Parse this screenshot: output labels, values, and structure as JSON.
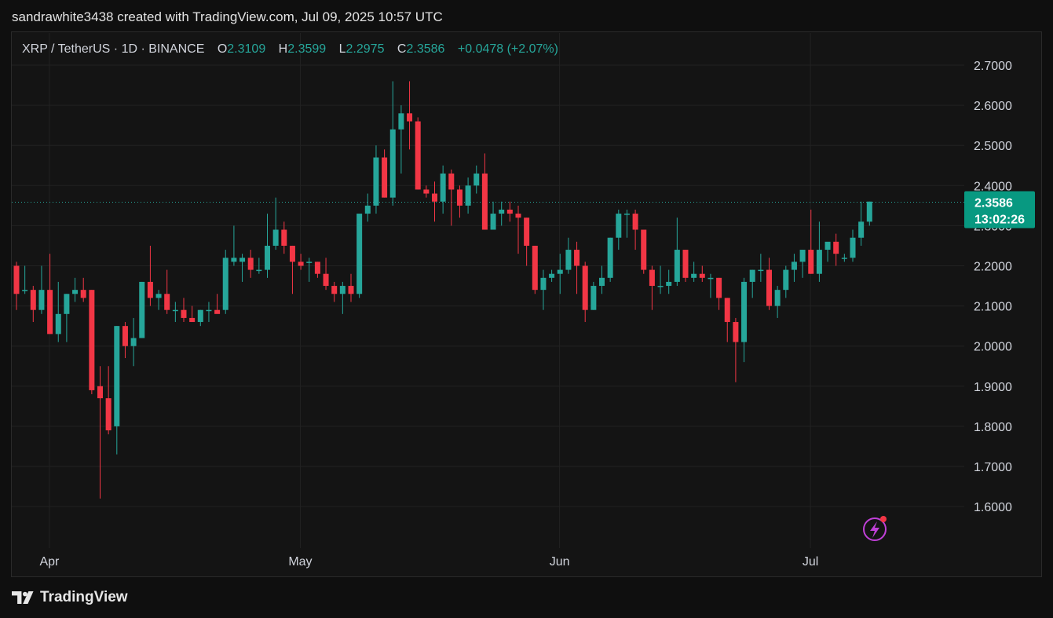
{
  "header": {
    "created_by": "sandrawhite3438 created with TradingView.com, Jul 09, 2025 10:57 UTC"
  },
  "legend": {
    "symbol": "XRP / TetherUS · 1D · BINANCE",
    "open_label": "O",
    "open": "2.3109",
    "high_label": "H",
    "high": "2.3599",
    "low_label": "L",
    "low": "2.2975",
    "close_label": "C",
    "close": "2.3586",
    "change": "+0.0478 (+2.07%)"
  },
  "price_badge": {
    "price": "2.3586",
    "countdown": "13:02:26"
  },
  "branding": {
    "logo_text": "TradingView"
  },
  "colors": {
    "up": "#26a69a",
    "down": "#f23645",
    "accent_badge": "#089981",
    "alert_icon": "#c040d8"
  },
  "icons": {
    "alert": "lightning-icon",
    "logo": "tradingview-logo-icon"
  },
  "chart_data": {
    "type": "candlestick",
    "y_ticks": [
      "2.7000",
      "2.6000",
      "2.5000",
      "2.4000",
      "2.3000",
      "2.2000",
      "2.1000",
      "2.0000",
      "1.9000",
      "1.8000",
      "1.7000",
      "1.6000"
    ],
    "ylim": [
      1.53,
      2.75
    ],
    "x_ticks": [
      {
        "label": "Apr",
        "index": 3
      },
      {
        "label": "May",
        "index": 33
      },
      {
        "label": "Jun",
        "index": 64
      },
      {
        "label": "Jul",
        "index": 94
      }
    ],
    "grid": true,
    "last_price_line": 2.3586,
    "candles": [
      [
        2.2,
        2.21,
        2.09,
        2.13
      ],
      [
        2.14,
        2.2,
        2.13,
        2.14
      ],
      [
        2.14,
        2.15,
        2.06,
        2.09
      ],
      [
        2.09,
        2.2,
        2.08,
        2.14
      ],
      [
        2.14,
        2.23,
        2.08,
        2.03
      ],
      [
        2.03,
        2.16,
        2.01,
        2.08
      ],
      [
        2.08,
        2.13,
        2.01,
        2.13
      ],
      [
        2.13,
        2.17,
        2.11,
        2.14
      ],
      [
        2.14,
        2.17,
        2.11,
        2.12
      ],
      [
        2.14,
        2.14,
        1.88,
        1.89
      ],
      [
        1.9,
        1.95,
        1.62,
        1.87
      ],
      [
        1.87,
        1.95,
        1.78,
        1.79
      ],
      [
        1.8,
        2.05,
        1.73,
        2.05
      ],
      [
        2.05,
        2.06,
        1.97,
        2.0
      ],
      [
        2.0,
        2.07,
        1.95,
        2.02
      ],
      [
        2.02,
        2.16,
        2.02,
        2.16
      ],
      [
        2.16,
        2.25,
        2.1,
        2.12
      ],
      [
        2.12,
        2.14,
        2.09,
        2.13
      ],
      [
        2.13,
        2.19,
        2.08,
        2.09
      ],
      [
        2.09,
        2.11,
        2.06,
        2.09
      ],
      [
        2.09,
        2.12,
        2.06,
        2.07
      ],
      [
        2.07,
        2.1,
        2.06,
        2.06
      ],
      [
        2.06,
        2.09,
        2.05,
        2.09
      ],
      [
        2.09,
        2.11,
        2.06,
        2.09
      ],
      [
        2.09,
        2.13,
        2.09,
        2.08
      ],
      [
        2.09,
        2.24,
        2.08,
        2.22
      ],
      [
        2.21,
        2.3,
        2.2,
        2.22
      ],
      [
        2.21,
        2.23,
        2.16,
        2.22
      ],
      [
        2.22,
        2.24,
        2.17,
        2.19
      ],
      [
        2.19,
        2.22,
        2.18,
        2.19
      ],
      [
        2.19,
        2.33,
        2.17,
        2.25
      ],
      [
        2.25,
        2.37,
        2.24,
        2.29
      ],
      [
        2.29,
        2.31,
        2.23,
        2.25
      ],
      [
        2.25,
        2.25,
        2.13,
        2.21
      ],
      [
        2.21,
        2.23,
        2.19,
        2.2
      ],
      [
        2.21,
        2.22,
        2.16,
        2.21
      ],
      [
        2.21,
        2.21,
        2.17,
        2.18
      ],
      [
        2.18,
        2.22,
        2.14,
        2.15
      ],
      [
        2.15,
        2.16,
        2.11,
        2.13
      ],
      [
        2.13,
        2.16,
        2.08,
        2.15
      ],
      [
        2.15,
        2.18,
        2.11,
        2.13
      ],
      [
        2.13,
        2.32,
        2.12,
        2.33
      ],
      [
        2.33,
        2.38,
        2.31,
        2.35
      ],
      [
        2.35,
        2.5,
        2.33,
        2.47
      ],
      [
        2.47,
        2.49,
        2.37,
        2.37
      ],
      [
        2.37,
        2.66,
        2.35,
        2.54
      ],
      [
        2.54,
        2.6,
        2.43,
        2.58
      ],
      [
        2.58,
        2.66,
        2.49,
        2.56
      ],
      [
        2.56,
        2.57,
        2.39,
        2.39
      ],
      [
        2.39,
        2.4,
        2.37,
        2.38
      ],
      [
        2.38,
        2.41,
        2.31,
        2.36
      ],
      [
        2.36,
        2.45,
        2.33,
        2.43
      ],
      [
        2.43,
        2.44,
        2.3,
        2.39
      ],
      [
        2.39,
        2.4,
        2.32,
        2.35
      ],
      [
        2.35,
        2.42,
        2.33,
        2.4
      ],
      [
        2.4,
        2.45,
        2.38,
        2.43
      ],
      [
        2.43,
        2.48,
        2.29,
        2.29
      ],
      [
        2.29,
        2.36,
        2.3,
        2.33
      ],
      [
        2.33,
        2.36,
        2.3,
        2.34
      ],
      [
        2.34,
        2.36,
        2.31,
        2.33
      ],
      [
        2.33,
        2.35,
        2.23,
        2.32
      ],
      [
        2.32,
        2.32,
        2.2,
        2.25
      ],
      [
        2.25,
        2.25,
        2.13,
        2.14
      ],
      [
        2.14,
        2.19,
        2.09,
        2.17
      ],
      [
        2.17,
        2.19,
        2.16,
        2.18
      ],
      [
        2.18,
        2.23,
        2.13,
        2.19
      ],
      [
        2.19,
        2.27,
        2.18,
        2.24
      ],
      [
        2.24,
        2.26,
        2.13,
        2.2
      ],
      [
        2.2,
        2.21,
        2.06,
        2.09
      ],
      [
        2.09,
        2.16,
        2.09,
        2.15
      ],
      [
        2.15,
        2.2,
        2.13,
        2.17
      ],
      [
        2.17,
        2.27,
        2.16,
        2.27
      ],
      [
        2.27,
        2.34,
        2.24,
        2.33
      ],
      [
        2.33,
        2.34,
        2.27,
        2.33
      ],
      [
        2.33,
        2.34,
        2.24,
        2.29
      ],
      [
        2.29,
        2.29,
        2.18,
        2.19
      ],
      [
        2.19,
        2.2,
        2.09,
        2.15
      ],
      [
        2.15,
        2.2,
        2.13,
        2.15
      ],
      [
        2.15,
        2.19,
        2.13,
        2.16
      ],
      [
        2.16,
        2.32,
        2.15,
        2.24
      ],
      [
        2.24,
        2.24,
        2.16,
        2.17
      ],
      [
        2.17,
        2.21,
        2.16,
        2.18
      ],
      [
        2.18,
        2.2,
        2.16,
        2.17
      ],
      [
        2.17,
        2.18,
        2.12,
        2.17
      ],
      [
        2.17,
        2.17,
        2.09,
        2.12
      ],
      [
        2.12,
        2.12,
        2.01,
        2.06
      ],
      [
        2.06,
        2.07,
        1.91,
        2.01
      ],
      [
        2.01,
        2.17,
        1.96,
        2.16
      ],
      [
        2.16,
        2.19,
        2.12,
        2.19
      ],
      [
        2.19,
        2.23,
        2.16,
        2.19
      ],
      [
        2.19,
        2.22,
        2.09,
        2.1
      ],
      [
        2.1,
        2.15,
        2.07,
        2.14
      ],
      [
        2.14,
        2.2,
        2.12,
        2.19
      ],
      [
        2.19,
        2.23,
        2.16,
        2.21
      ],
      [
        2.21,
        2.24,
        2.17,
        2.24
      ],
      [
        2.24,
        2.34,
        2.18,
        2.18
      ],
      [
        2.18,
        2.31,
        2.16,
        2.24
      ],
      [
        2.24,
        2.25,
        2.21,
        2.26
      ],
      [
        2.26,
        2.28,
        2.2,
        2.23
      ],
      [
        2.22,
        2.23,
        2.21,
        2.22
      ],
      [
        2.22,
        2.29,
        2.21,
        2.27
      ],
      [
        2.27,
        2.36,
        2.25,
        2.31
      ],
      [
        2.31,
        2.36,
        2.3,
        2.36
      ]
    ]
  }
}
